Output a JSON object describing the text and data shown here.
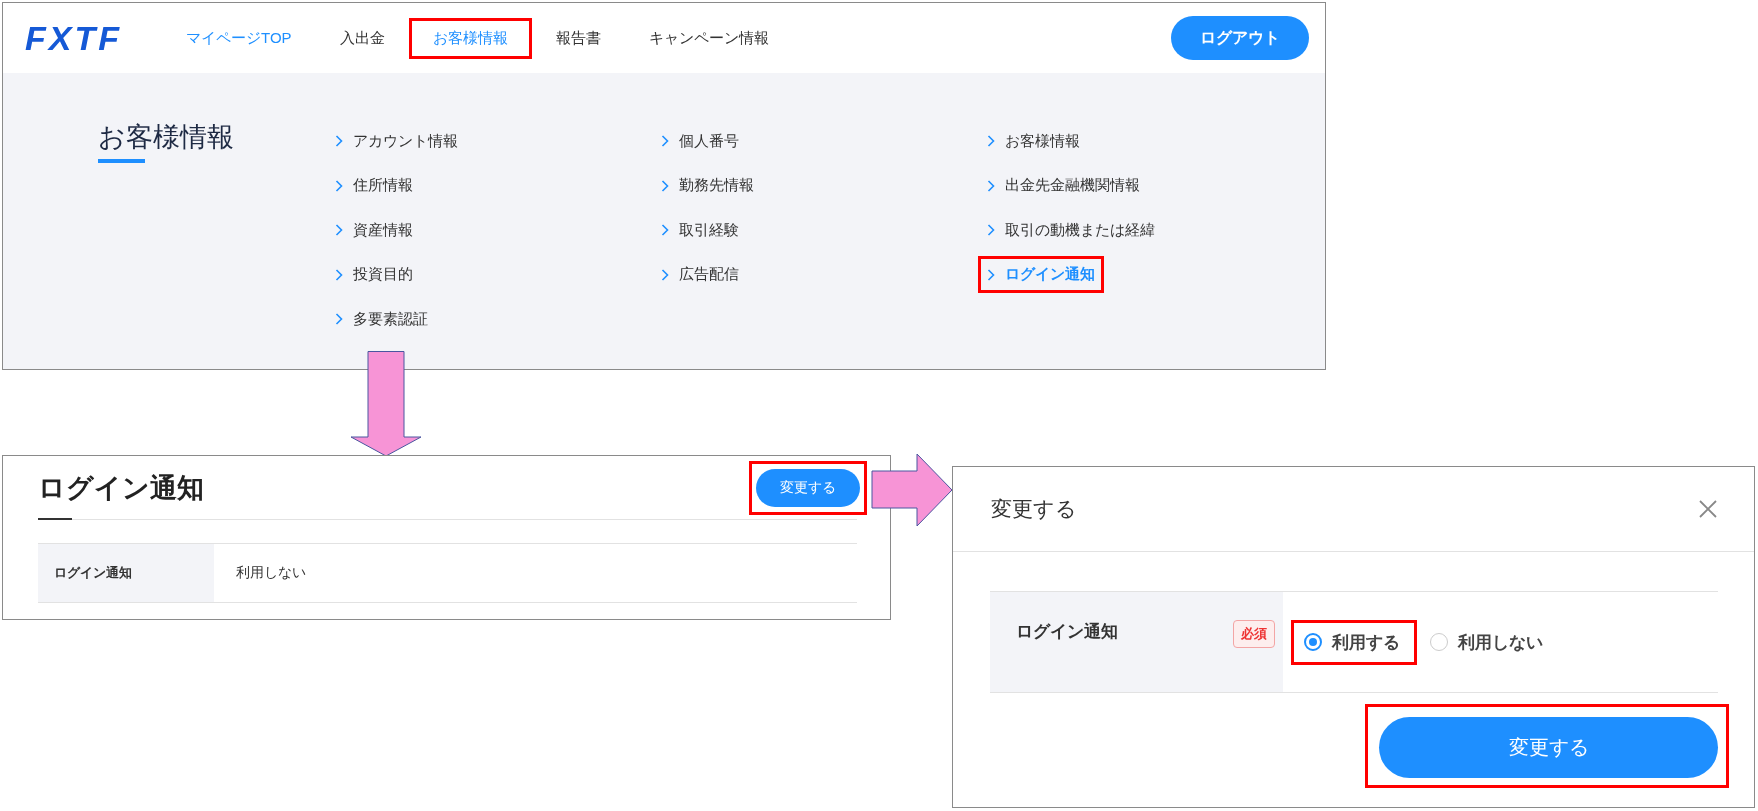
{
  "logo": {
    "text": "FXTF"
  },
  "nav": {
    "items": [
      {
        "label": "マイページTOP",
        "selected": true,
        "highlighted": false
      },
      {
        "label": "入出金",
        "selected": false,
        "highlighted": false
      },
      {
        "label": "お客様情報",
        "selected": true,
        "highlighted": true
      },
      {
        "label": "報告書",
        "selected": false,
        "highlighted": false
      },
      {
        "label": "キャンペーン情報",
        "selected": false,
        "highlighted": false
      }
    ],
    "logout": "ログアウト"
  },
  "menu": {
    "title": "お客様情報",
    "columns": [
      {
        "items": [
          {
            "label": "アカウント情報",
            "selected": false,
            "highlighted": false
          },
          {
            "label": "住所情報",
            "selected": false,
            "highlighted": false
          },
          {
            "label": "資産情報",
            "selected": false,
            "highlighted": false
          },
          {
            "label": "投資目的",
            "selected": false,
            "highlighted": false
          },
          {
            "label": "多要素認証",
            "selected": false,
            "highlighted": false
          }
        ]
      },
      {
        "items": [
          {
            "label": "個人番号",
            "selected": false,
            "highlighted": false
          },
          {
            "label": "勤務先情報",
            "selected": false,
            "highlighted": false
          },
          {
            "label": "取引経験",
            "selected": false,
            "highlighted": false
          },
          {
            "label": "広告配信",
            "selected": false,
            "highlighted": false
          }
        ]
      },
      {
        "items": [
          {
            "label": "お客様情報",
            "selected": false,
            "highlighted": false
          },
          {
            "label": "出金先金融機関情報",
            "selected": false,
            "highlighted": false
          },
          {
            "label": "取引の動機または経緯",
            "selected": false,
            "highlighted": false
          },
          {
            "label": "ログイン通知",
            "selected": true,
            "highlighted": true
          }
        ]
      }
    ]
  },
  "detail": {
    "title": "ログイン通知",
    "button": {
      "label": "変更する",
      "highlighted": true
    },
    "rows": [
      {
        "label": "ログイン通知",
        "value": "利用しない"
      }
    ]
  },
  "dialog": {
    "title": "変更する",
    "field": {
      "label": "ログイン通知",
      "badge": "必須",
      "options": [
        {
          "label": "利用する",
          "selected": true,
          "highlighted": true
        },
        {
          "label": "利用しない",
          "selected": false,
          "highlighted": false
        }
      ]
    },
    "submit": {
      "label": "変更する",
      "highlighted": true
    }
  }
}
